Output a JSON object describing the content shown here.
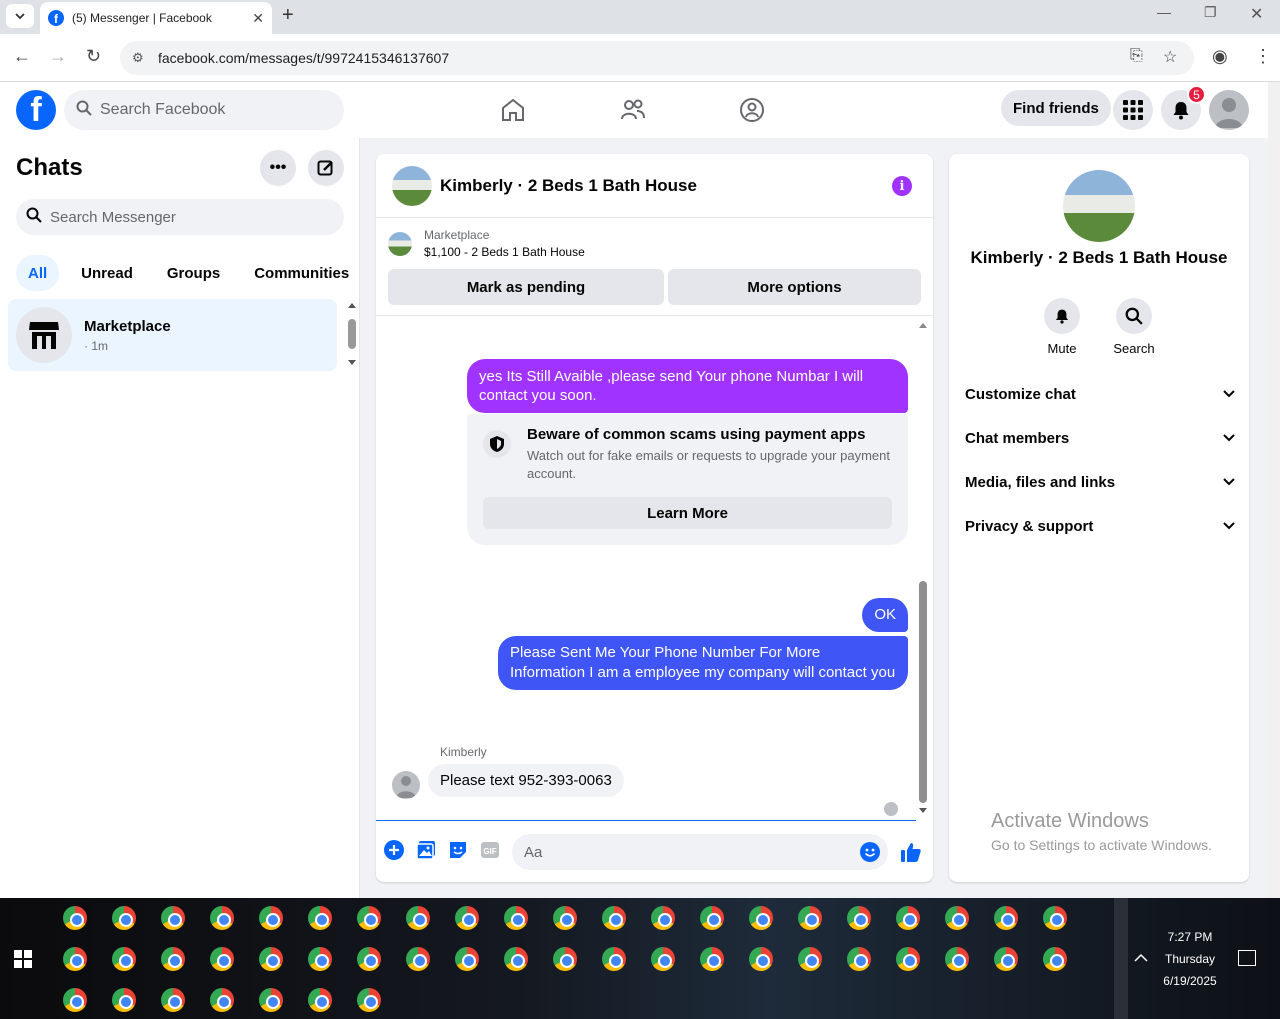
{
  "browser": {
    "tab_title": "(5) Messenger | Facebook",
    "url": "facebook.com/messages/t/9972415346137607"
  },
  "header": {
    "search_placeholder": "Search Facebook",
    "find_friends": "Find friends",
    "notification_count": "5"
  },
  "chats": {
    "title": "Chats",
    "search_placeholder": "Search Messenger",
    "filters": [
      "All",
      "Unread",
      "Groups",
      "Communities"
    ],
    "items": [
      {
        "name": "Marketplace",
        "time": "· 1m"
      }
    ]
  },
  "conversation": {
    "title": "Kimberly · 2 Beds 1 Bath House",
    "listing_source": "Marketplace",
    "listing_title": "$1,100 - 2 Beds 1 Bath House",
    "mark_pending": "Mark as pending",
    "more_options": "More options",
    "messages": [
      {
        "text": "yes Its Still Avaible ,please send Your phone Numbar I will contact you soon."
      },
      {
        "text": "OK"
      },
      {
        "text": "Please Sent Me Your Phone Number For More Information I am a employee my company will contact you"
      },
      {
        "text": "Please text 952-393-0063"
      }
    ],
    "scam_title": "Beware of common scams using payment apps",
    "scam_desc": "Watch out for fake emails or requests to upgrade your payment account.",
    "learn_more": "Learn More",
    "incoming_sender": "Kimberly",
    "composer_placeholder": "Aa"
  },
  "details": {
    "name": "Kimberly · 2 Beds 1 Bath House",
    "mute": "Mute",
    "search": "Search",
    "sections": [
      "Customize chat",
      "Chat members",
      "Media, files and links",
      "Privacy & support"
    ]
  },
  "watermark": {
    "line1": "Activate Windows",
    "line2": "Go to Settings to activate Windows."
  },
  "taskbar": {
    "time": "7:27 PM",
    "day": "Thursday",
    "date": "6/19/2025"
  },
  "colors": {
    "brand": "#0866ff",
    "purple": "#a033ff",
    "outgoing": "#3f55f5"
  }
}
